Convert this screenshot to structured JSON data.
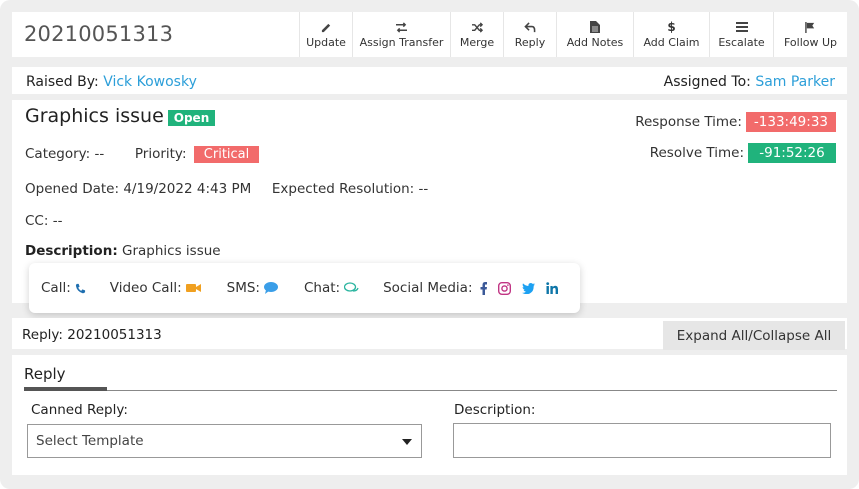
{
  "ticket": {
    "id": "20210051313"
  },
  "toolbar": [
    {
      "label": "Update",
      "icon": "pencil-icon"
    },
    {
      "label": "Assign Transfer",
      "icon": "transfer-icon"
    },
    {
      "label": "Merge",
      "icon": "shuffle-icon"
    },
    {
      "label": "Reply",
      "icon": "reply-icon"
    },
    {
      "label": "Add Notes",
      "icon": "file-icon"
    },
    {
      "label": "Add Claim",
      "icon": "dollar-icon"
    },
    {
      "label": "Escalate",
      "icon": "list-icon"
    },
    {
      "label": "Follow Up",
      "icon": "flag-icon"
    }
  ],
  "people": {
    "raised_label": "Raised By:",
    "raised_name": "Vick Kowosky",
    "assigned_label": "Assigned To:",
    "assigned_name": "Sam Parker"
  },
  "details": {
    "title": "Graphics issue",
    "status": "Open",
    "category_label": "Category:",
    "category_value": "--",
    "priority_label": "Priority:",
    "priority_value": "Critical",
    "opened_label": "Opened Date:",
    "opened_value": "4/19/2022 4:43 PM",
    "expected_label": "Expected Resolution:",
    "expected_value": "--",
    "cc_label": "CC:",
    "cc_value": "--",
    "description_label": "Description:",
    "description_value": "Graphics issue"
  },
  "timers": {
    "response_label": "Response Time:",
    "response_value": "-133:49:33",
    "resolve_label": "Resolve Time:",
    "resolve_value": "-91:52:26"
  },
  "contact": {
    "call": "Call:",
    "video": "Video Call:",
    "sms": "SMS:",
    "chat": "Chat:",
    "social": "Social Media:"
  },
  "reply": {
    "header": "Reply: 20210051313",
    "expand_button": "Expand All/Collapse All",
    "tab": "Reply",
    "canned_label": "Canned Reply:",
    "canned_value": "Select Template",
    "description_label": "Description:"
  },
  "colors": {
    "link": "#2d9fd9",
    "open": "#20b37c",
    "critical": "#f26b6b",
    "phone": "#1f6fb0",
    "video": "#f0a020",
    "sms": "#3a9ee8",
    "chat": "#2bb5a0",
    "facebook": "#3b5998",
    "instagram": "#c13584",
    "twitter": "#1da1f2",
    "linkedin": "#0e76a8"
  }
}
